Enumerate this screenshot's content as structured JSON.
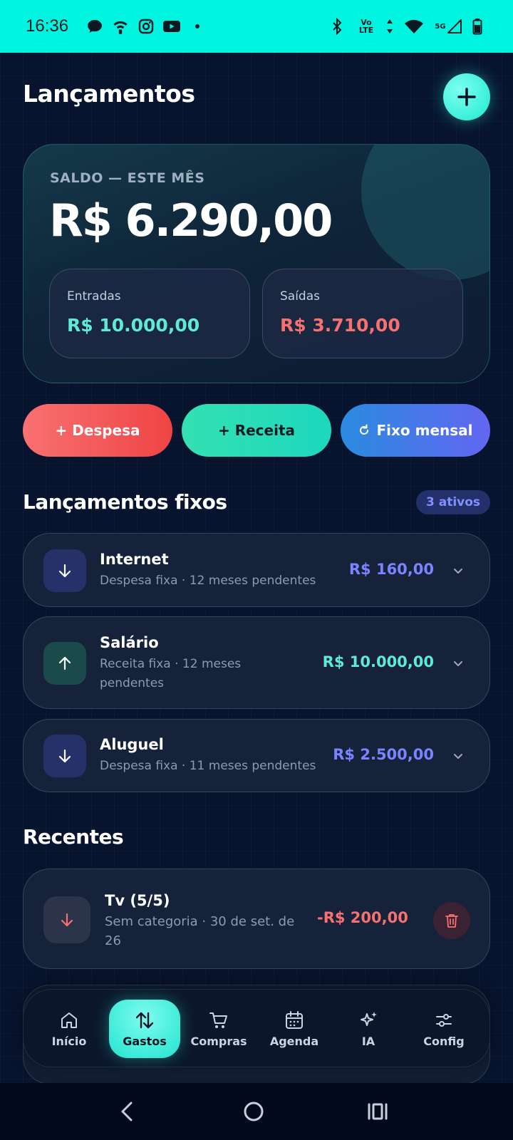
{
  "status_bar": {
    "time": "16:36",
    "left_icons": [
      "chat-bubble-icon",
      "wifi-call-icon",
      "instagram-icon",
      "youtube-icon",
      "dot-icon"
    ],
    "right_icons": [
      "bluetooth-icon",
      "volte-icon",
      "data-arrows-icon",
      "wifi-icon",
      "5g-signal-icon",
      "battery-icon"
    ],
    "volte_top": "Vo",
    "volte_bottom": "LTE",
    "network": "5G",
    "background_color": "#00f5e0"
  },
  "header": {
    "title": "Lançamentos",
    "add_button_label": "+"
  },
  "balance": {
    "label": "SALDO — ESTE MÊS",
    "value": "R$ 6.290,00",
    "income_label": "Entradas",
    "income_value": "R$ 10.000,00",
    "income_color": "#5eead4",
    "expense_label": "Saídas",
    "expense_value": "R$ 3.710,00",
    "expense_color": "#f87171"
  },
  "actions": {
    "expense_label": "+ Despesa",
    "income_label": "+ Receita",
    "fixed_label": "Fixo mensal",
    "fixed_icon": "refresh-icon"
  },
  "fixed_section": {
    "title": "Lançamentos fixos",
    "count_badge": "3 ativos",
    "items": [
      {
        "name": "Internet",
        "subtitle": "Despesa fixa · 12 meses pendentes",
        "amount": "R$ 160,00",
        "type": "expense",
        "icon": "arrow-down-icon",
        "color": "#7c83ff"
      },
      {
        "name": "Salário",
        "subtitle": "Receita fixa · 12 meses pendentes",
        "amount": "R$ 10.000,00",
        "type": "income",
        "icon": "arrow-up-icon",
        "color": "#5eead4"
      },
      {
        "name": "Aluguel",
        "subtitle": "Despesa fixa · 11 meses pendentes",
        "amount": "R$ 2.500,00",
        "type": "expense",
        "icon": "arrow-down-icon",
        "color": "#7c83ff"
      }
    ]
  },
  "recent_section": {
    "title": "Recentes",
    "items": [
      {
        "name": "Tv (5/5)",
        "subtitle": "Sem categoria · 30 de set. de 26",
        "amount": "-R$ 200,00",
        "icon": "arrow-down-icon",
        "color": "#f87171"
      }
    ]
  },
  "bottom_nav": {
    "items": [
      {
        "label": "Início",
        "icon": "home-icon",
        "active": false
      },
      {
        "label": "Gastos",
        "icon": "swap-vertical-icon",
        "active": true
      },
      {
        "label": "Compras",
        "icon": "cart-icon",
        "active": false
      },
      {
        "label": "Agenda",
        "icon": "calendar-icon",
        "active": false
      },
      {
        "label": "IA",
        "icon": "sparkles-icon",
        "active": false
      },
      {
        "label": "Config",
        "icon": "sliders-icon",
        "active": false
      }
    ],
    "accent_color": "#22e5cf"
  },
  "system_nav": {
    "buttons": [
      "back-icon",
      "home-circle-icon",
      "recents-icon"
    ]
  }
}
